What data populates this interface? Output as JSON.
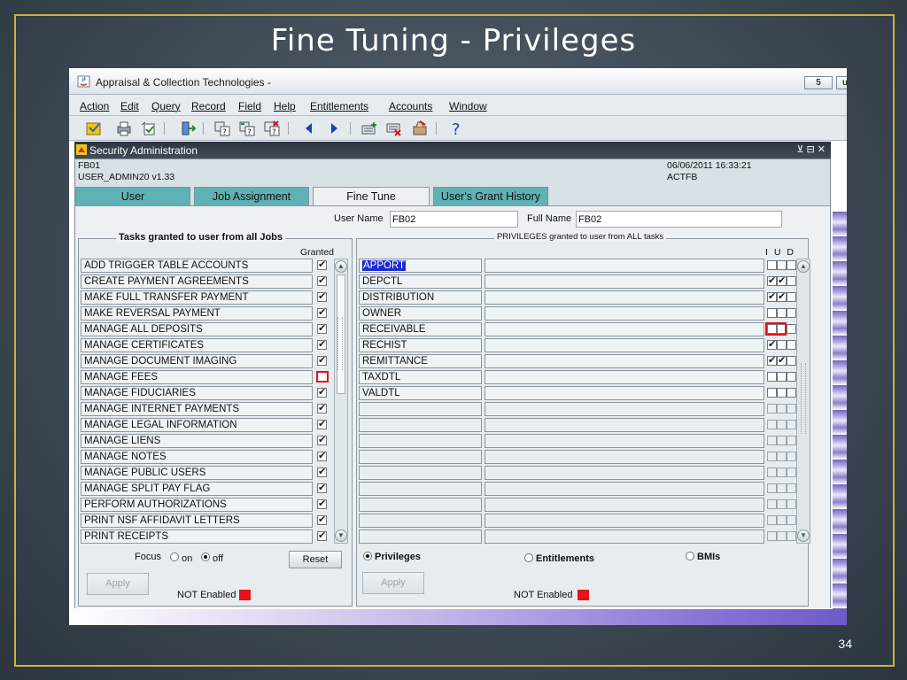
{
  "slide": {
    "title": "Fine Tuning - Privileges",
    "number": "34"
  },
  "window": {
    "title": "Appraisal & Collection Technologies -",
    "controls": [
      "5",
      "u"
    ]
  },
  "menu": [
    "Action",
    "Edit",
    "Query",
    "Record",
    "Field",
    "Help",
    "Entitlements",
    "Accounts",
    "Window"
  ],
  "security": {
    "title": "Security Administration",
    "controls": "⊻ ⊟ ✕",
    "left_line1": "FB01",
    "left_line2": "USER_ADMIN20 v1.33",
    "right_line1": "06/06/2011 16:33:21",
    "right_line2": "ACTFB"
  },
  "tabs": [
    "User",
    "Job Assignment",
    "Fine Tune",
    "User's Grant History"
  ],
  "user": {
    "name_label": "User Name",
    "name_value": "FB02",
    "full_label": "Full Name",
    "full_value": "FB02"
  },
  "tasks": {
    "title": "Tasks granted to user from all Jobs",
    "granted_header": "Granted",
    "items": [
      {
        "name": "ADD TRIGGER TABLE ACCOUNTS",
        "granted": true
      },
      {
        "name": "CREATE PAYMENT AGREEMENTS",
        "granted": true
      },
      {
        "name": "MAKE FULL TRANSFER PAYMENT",
        "granted": true
      },
      {
        "name": "MAKE REVERSAL PAYMENT",
        "granted": true
      },
      {
        "name": "MANAGE ALL DEPOSITS",
        "granted": true
      },
      {
        "name": "MANAGE CERTIFICATES",
        "granted": true
      },
      {
        "name": "MANAGE DOCUMENT IMAGING",
        "granted": true
      },
      {
        "name": "MANAGE FEES",
        "granted": false,
        "highlight": true
      },
      {
        "name": "MANAGE FIDUCIARIES",
        "granted": true
      },
      {
        "name": "MANAGE INTERNET PAYMENTS",
        "granted": true
      },
      {
        "name": "MANAGE LEGAL INFORMATION",
        "granted": true
      },
      {
        "name": "MANAGE LIENS",
        "granted": true
      },
      {
        "name": "MANAGE NOTES",
        "granted": true
      },
      {
        "name": "MANAGE PUBLIC USERS",
        "granted": true
      },
      {
        "name": "MANAGE SPLIT PAY FLAG",
        "granted": true
      },
      {
        "name": "PERFORM AUTHORIZATIONS",
        "granted": true
      },
      {
        "name": "PRINT NSF AFFIDAVIT LETTERS",
        "granted": true
      },
      {
        "name": "PRINT RECEIPTS",
        "granted": true
      }
    ],
    "focus_label": "Focus",
    "focus_on": "on",
    "focus_off": "off",
    "reset": "Reset",
    "apply": "Apply",
    "not_enabled": "NOT Enabled"
  },
  "privileges": {
    "title": "PRIVILEGES granted to user from ALL tasks",
    "iud_header": "I U D",
    "rows": [
      {
        "name": "APPORT",
        "i": false,
        "u": false,
        "d": false,
        "selected": true
      },
      {
        "name": "DEPCTL",
        "i": true,
        "u": true,
        "d": false
      },
      {
        "name": "DISTRIBUTION",
        "i": true,
        "u": true,
        "d": false
      },
      {
        "name": "OWNER",
        "i": false,
        "u": false,
        "d": false
      },
      {
        "name": "RECEIVABLE",
        "i": false,
        "u": false,
        "d": false,
        "highlight": true
      },
      {
        "name": "RECHIST",
        "i": true,
        "u": false,
        "d": false
      },
      {
        "name": "REMITTANCE",
        "i": true,
        "u": true,
        "d": false
      },
      {
        "name": "TAXDTL",
        "i": false,
        "u": false,
        "d": false
      },
      {
        "name": "VALDTL",
        "i": false,
        "u": false,
        "d": false
      },
      {
        "name": "",
        "empty": true
      },
      {
        "name": "",
        "empty": true
      },
      {
        "name": "",
        "empty": true
      },
      {
        "name": "",
        "empty": true
      },
      {
        "name": "",
        "empty": true
      },
      {
        "name": "",
        "empty": true
      },
      {
        "name": "",
        "empty": true
      },
      {
        "name": "",
        "empty": true
      },
      {
        "name": "",
        "empty": true
      }
    ],
    "radio_privileges": "Privileges",
    "radio_entitlements": "Entitlements",
    "radio_bmis": "BMIs",
    "apply": "Apply",
    "not_enabled": "NOT Enabled"
  }
}
